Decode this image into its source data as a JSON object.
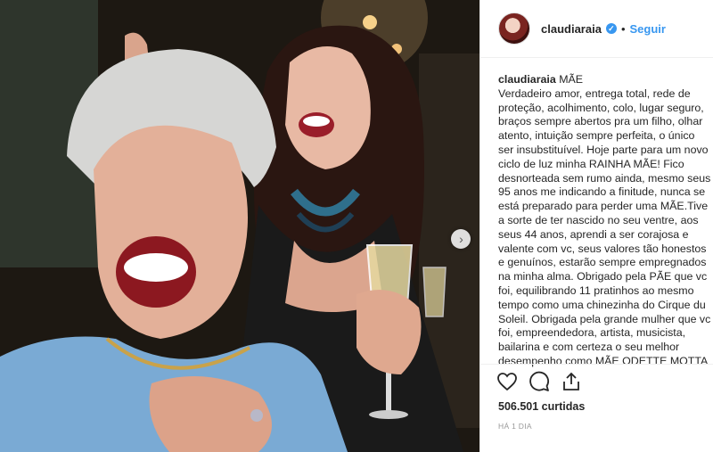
{
  "post": {
    "photo_alt": "Two women laughing at a party",
    "carousel_next": "›"
  },
  "header": {
    "username": "claudiaraia",
    "verified_mark": "✓",
    "separator": "•",
    "follow_label": "Seguir"
  },
  "caption": {
    "username": "claudiaraia",
    "text": " MÃE\nVerdadeiro amor, entrega total, rede de proteção, acolhimento, colo, lugar seguro, braços sempre abertos pra um filho, olhar atento, intuição sempre perfeita, o único ser insubstituível. Hoje parte para um novo ciclo de luz minha RAINHA MÃE! Fico desnorteada sem rumo ainda, mesmo seus 95 anos me indicando a finitude, nunca se está preparado para perder uma MÃE.Tive a sorte de ter nascido no seu ventre, aos seus 44 anos, aprendi a ser corajosa e valente com vc, seus valores tão honestos e genuínos, estarão sempre empregnados na minha alma. Obrigado pela PÃE que vc foi, equilibrando 11 pratinhos ao mesmo tempo como uma chinezinha do Cirque du Soleil. Obrigada pela grande mulher que vc foi, empreendedora, artista, musicista, bailarina e com certeza o seu melhor desempenho como MÃE ODETTE MOTTA"
  },
  "actions": {
    "like_icon": "heart-icon",
    "comment_icon": "comment-icon",
    "share_icon": "share-icon"
  },
  "likes_text": "506.501 curtidas",
  "timestamp": "HÁ 1 DIA",
  "colors": {
    "accent": "#3897f0",
    "text": "#262626",
    "muted": "#999999"
  }
}
